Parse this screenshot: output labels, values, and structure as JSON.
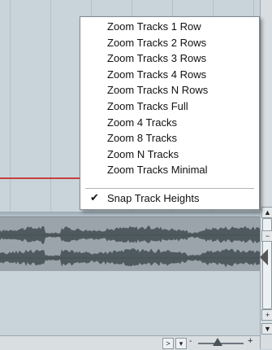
{
  "context_menu": {
    "items": [
      "Zoom Tracks 1 Row",
      "Zoom Tracks 2 Rows",
      "Zoom Tracks 3 Rows",
      "Zoom Tracks 4 Rows",
      "Zoom Tracks N Rows",
      "Zoom Tracks Full",
      "Zoom 4 Tracks",
      "Zoom 8 Tracks",
      "Zoom N Tracks",
      "Zoom Tracks Minimal"
    ],
    "toggle_item": {
      "label": "Snap Track Heights",
      "checked": true,
      "check_glyph": "✔"
    }
  },
  "scrollbar": {
    "up_glyph": "▲",
    "down_glyph": "▼",
    "zoom_minus": "−",
    "zoom_plus": "+"
  },
  "bottom_bar": {
    "scroll_right_glyph": ">",
    "zoom_menu_glyph": "▾",
    "zoom_minus": "-",
    "zoom_plus": "+"
  },
  "colors": {
    "arranger_bg": "#c9d4da",
    "locator": "#c7403b",
    "menu_bg": "#ffffff",
    "waveform": "#4f5a60"
  }
}
